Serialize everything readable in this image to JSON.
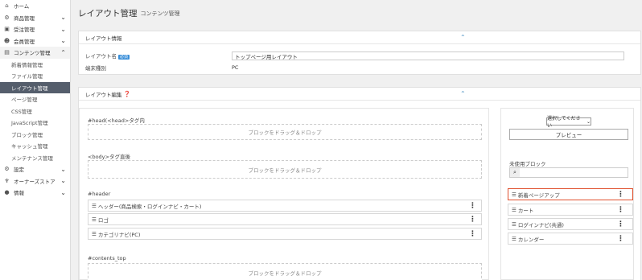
{
  "sidebar": {
    "items": [
      {
        "icon": "home-icon",
        "glyph": "⌂",
        "label": "ホーム"
      },
      {
        "icon": "gear-icon",
        "glyph": "⚙",
        "label": "商品管理"
      },
      {
        "icon": "cart-icon",
        "glyph": "▣",
        "label": "受注管理"
      },
      {
        "icon": "users-icon",
        "glyph": "☻",
        "label": "会員管理"
      },
      {
        "icon": "file-icon",
        "glyph": "▤",
        "label": "コンテンツ管理"
      }
    ],
    "subitems": [
      "新着情報管理",
      "ファイル管理",
      "レイアウト管理",
      "ページ管理",
      "CSS管理",
      "JavaScript管理",
      "ブロック管理",
      "キャッシュ管理",
      "メンテナンス管理"
    ],
    "bottom": [
      {
        "icon": "gear-icon",
        "glyph": "⚙",
        "label": "設定"
      },
      {
        "icon": "plug-icon",
        "glyph": "♆",
        "label": "オーナーズストア"
      },
      {
        "icon": "info-icon",
        "glyph": "●",
        "label": "情報"
      }
    ]
  },
  "header": {
    "title": "レイアウト管理",
    "subtitle": "コンテンツ管理"
  },
  "layout_info": {
    "title": "レイアウト情報",
    "name_label": "レイアウト名",
    "required": "必須",
    "name_value": "トップページ用レイアウト",
    "device_label": "端末種別",
    "device_value": "PC"
  },
  "layout_edit": {
    "title": "レイアウト編集"
  },
  "left": {
    "head": "<head>",
    "head_title": "#head(<head>タグ内",
    "drop_text": "ブロックをドラッグ＆ドロップ",
    "body_title": "<body>タグ直後",
    "header_title": "#header",
    "header_blocks": [
      "ヘッダー(商品検索・ログインナビ・カート)",
      "ロゴ",
      "カテゴリナビ(PC)"
    ],
    "contents_top_title": "#contents_top"
  },
  "right": {
    "select_label": "選択してください",
    "preview": "プレビュー",
    "unused_title": "未使用ブロック",
    "blocks": [
      "新着ページアップ",
      "カート",
      "ログインナビ(共通)",
      "カレンダー"
    ]
  },
  "menu_glyph": "⋮",
  "drag_glyph": "☰"
}
